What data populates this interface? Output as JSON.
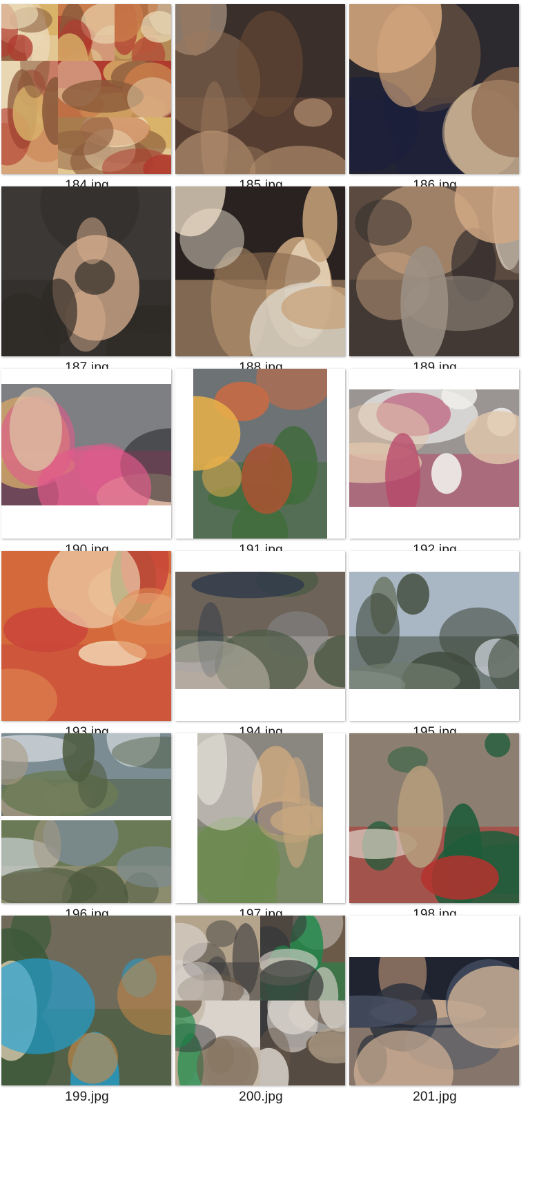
{
  "files": [
    {
      "name": "184.jpg",
      "desc": "food-collage-icon"
    },
    {
      "name": "185.jpg",
      "desc": "selfie-icon"
    },
    {
      "name": "186.jpg",
      "desc": "selfie-icon"
    },
    {
      "name": "187.jpg",
      "desc": "selfie-icon"
    },
    {
      "name": "188.jpg",
      "desc": "birthday-cake-photo-icon"
    },
    {
      "name": "189.jpg",
      "desc": "group-selfie-icon"
    },
    {
      "name": "190.jpg",
      "desc": "group-photo-icon"
    },
    {
      "name": "191.jpg",
      "desc": "food-table-icon"
    },
    {
      "name": "192.jpg",
      "desc": "group-photo-icon"
    },
    {
      "name": "193.jpg",
      "desc": "seafood-dish-icon"
    },
    {
      "name": "194.jpg",
      "desc": "waterfall-photo-icon"
    },
    {
      "name": "195.jpg",
      "desc": "mountain-view-photo-icon"
    },
    {
      "name": "196.jpg",
      "desc": "landscape-collage-icon"
    },
    {
      "name": "197.jpg",
      "desc": "cafe-portrait-icon"
    },
    {
      "name": "198.jpg",
      "desc": "backpack-coffee-icon"
    },
    {
      "name": "199.jpg",
      "desc": "coffee-cup-icon"
    },
    {
      "name": "200.jpg",
      "desc": "cafe-collage-icon"
    },
    {
      "name": "201.jpg",
      "desc": "group-photo-icon"
    }
  ]
}
